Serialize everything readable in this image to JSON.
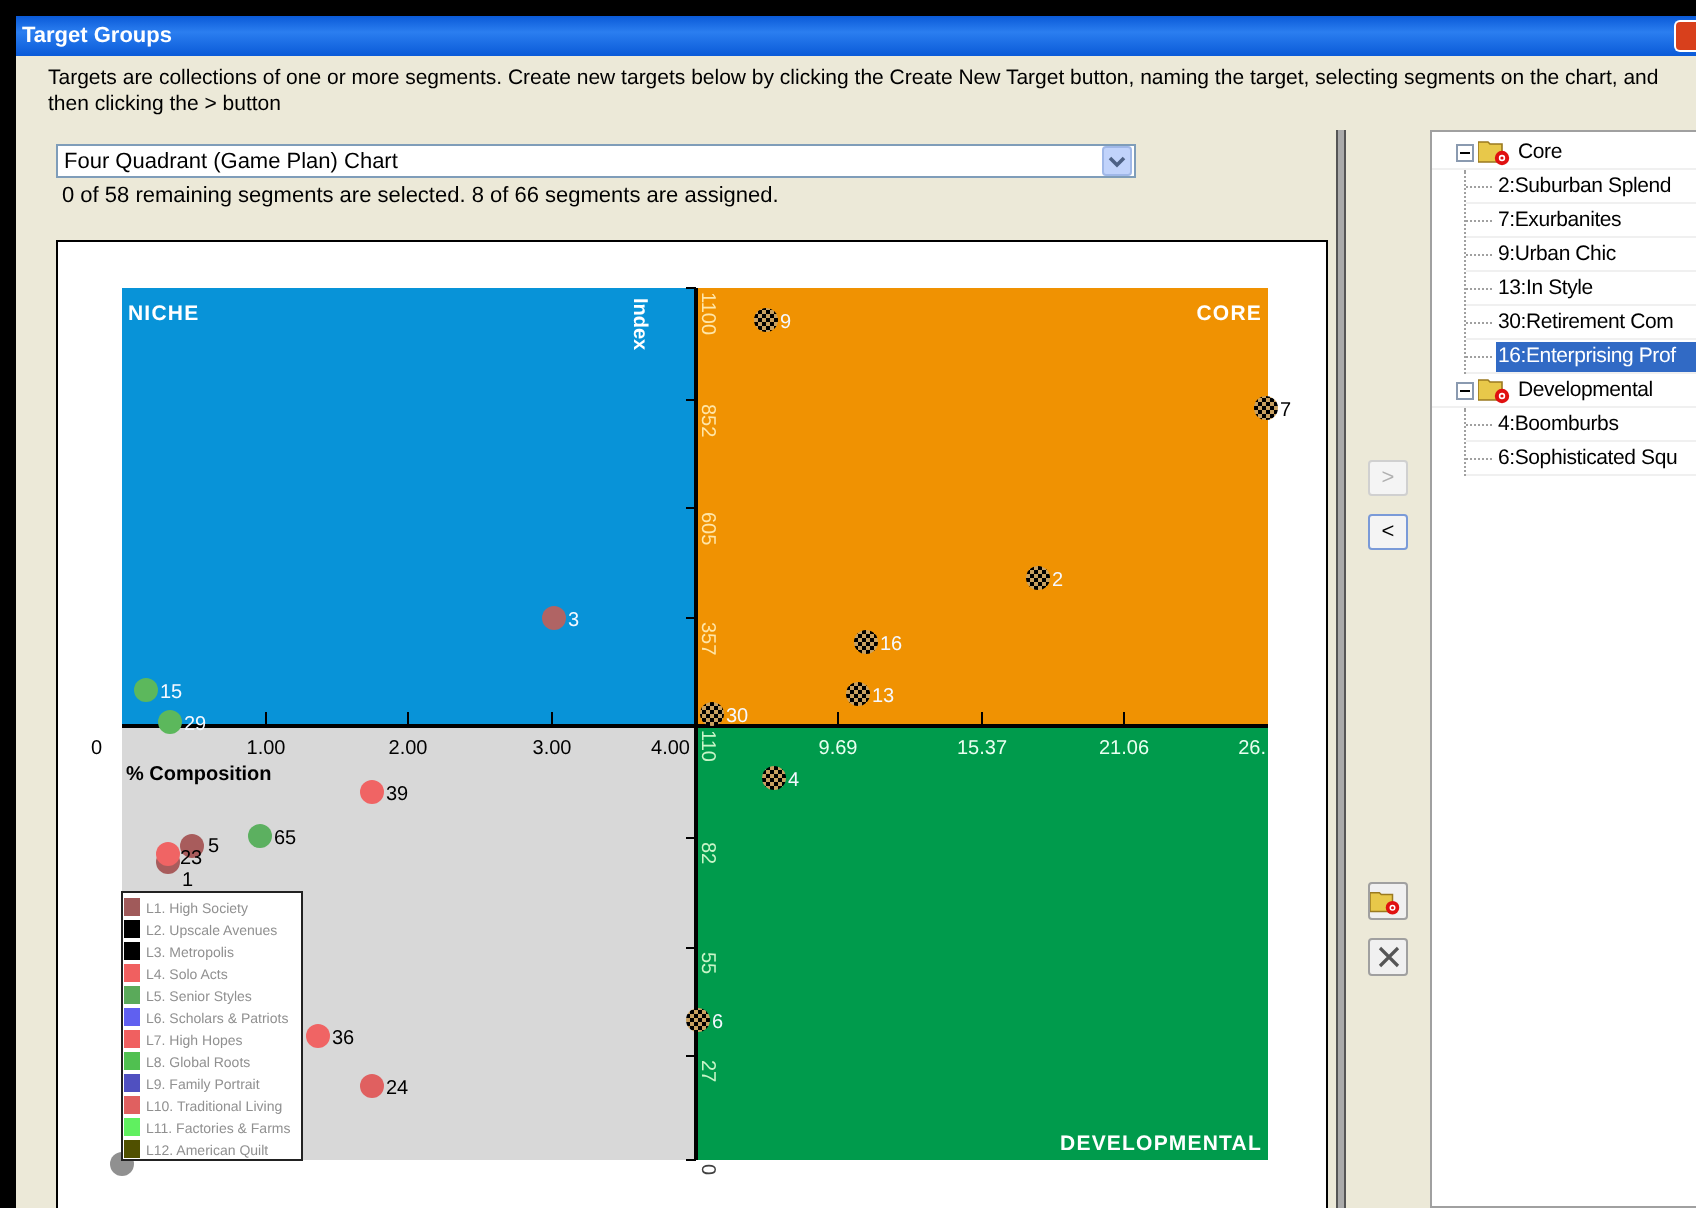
{
  "window": {
    "title": "Target Groups"
  },
  "instructions": "Targets are collections of one or more segments.  Create new targets below by clicking the Create New Target button, naming the target, selecting segments on the chart, and then clicking the > button",
  "chart_selector": {
    "value": "Four Quadrant (Game Plan) Chart"
  },
  "status_text": "0 of 58 remaining segments are selected. 8 of 66 segments are assigned.",
  "chart": {
    "x_axis_title": "% Composition",
    "y_axis_title": "Index",
    "x_tick_labels": [
      "0",
      "1.00",
      "2.00",
      "3.00",
      "4.00",
      "9.69",
      "15.37",
      "21.06",
      "26."
    ],
    "y_tick_labels": [
      "1100",
      "852",
      "605",
      "357",
      "110",
      "82",
      "55",
      "27",
      "0"
    ],
    "quadrants": [
      {
        "kind": "top-left",
        "title": "NICHE",
        "color": "#0893d8"
      },
      {
        "kind": "top-right",
        "title": "CORE",
        "color": "#f09202"
      },
      {
        "kind": "bottom-left",
        "color": "#d8d8d8"
      },
      {
        "kind": "bottom-right",
        "title": "DEVELOPMENTAL",
        "color": "#009b4c"
      }
    ],
    "points": [
      {
        "kind": "solid",
        "label": "3",
        "color": "#b06464"
      },
      {
        "kind": "solid",
        "label": "15",
        "color": "#5cb85c"
      },
      {
        "kind": "solid",
        "label": "29",
        "color": "#5cb85c"
      },
      {
        "kind": "solid",
        "label": "39",
        "color": "#f06464"
      },
      {
        "kind": "solid",
        "label": "65",
        "color": "#5cb060"
      },
      {
        "kind": "solid",
        "label": "1",
        "color": "#a85c5c"
      },
      {
        "kind": "solid",
        "label": "5",
        "color": "#a85c5c"
      },
      {
        "kind": "solid",
        "label": "23",
        "color": "#f06464"
      },
      {
        "kind": "solid",
        "label": "36",
        "color": "#f06464"
      },
      {
        "kind": "solid",
        "label": "24",
        "color": "#e06060"
      },
      {
        "kind": "solid",
        "color": "#909090"
      },
      {
        "kind": "hatched",
        "label": "9"
      },
      {
        "kind": "hatched",
        "label": "7"
      },
      {
        "kind": "hatched",
        "label": "2"
      },
      {
        "kind": "hatched",
        "label": "16"
      },
      {
        "kind": "hatched",
        "label": "13"
      },
      {
        "kind": "hatched",
        "label": "30"
      },
      {
        "kind": "hatched",
        "label": "4"
      },
      {
        "kind": "hatched",
        "label": "6"
      }
    ],
    "legend": [
      {
        "label": "L1. High Society",
        "color": "#a05a5a"
      },
      {
        "label": "L2. Upscale Avenues",
        "color": "#000000"
      },
      {
        "label": "L3. Metropolis",
        "color": "#000000"
      },
      {
        "label": "L4. Solo Acts",
        "color": "#f06060"
      },
      {
        "label": "L5. Senior Styles",
        "color": "#5aaa5a"
      },
      {
        "label": "L6. Scholars & Patriots",
        "color": "#6060f0"
      },
      {
        "label": "L7. High Hopes",
        "color": "#f06060"
      },
      {
        "label": "L8. Global Roots",
        "color": "#50c050"
      },
      {
        "label": "L9. Family Portrait",
        "color": "#5050c0"
      },
      {
        "label": "L10. Traditional Living",
        "color": "#e06060"
      },
      {
        "label": "L11. Factories & Farms",
        "color": "#60f060"
      },
      {
        "label": "L12. American Quilt",
        "color": "#505000"
      }
    ]
  },
  "move_buttons": [
    {
      "label": ">",
      "disabled": true
    },
    {
      "label": "<",
      "disabled": false
    }
  ],
  "tree": [
    {
      "label": "Core",
      "expanded": true,
      "children": [
        {
          "label": "2:Suburban Splend",
          "selected": false
        },
        {
          "label": "7:Exurbanites",
          "selected": false
        },
        {
          "label": "9:Urban Chic",
          "selected": false
        },
        {
          "label": "13:In Style",
          "selected": false
        },
        {
          "label": "30:Retirement Com",
          "selected": false
        },
        {
          "label": "16:Enterprising Prof",
          "selected": true
        }
      ]
    },
    {
      "label": "Developmental",
      "expanded": true,
      "children": [
        {
          "label": "4:Boomburbs",
          "selected": false
        },
        {
          "label": "6:Sophisticated Squ",
          "selected": false
        }
      ]
    }
  ]
}
